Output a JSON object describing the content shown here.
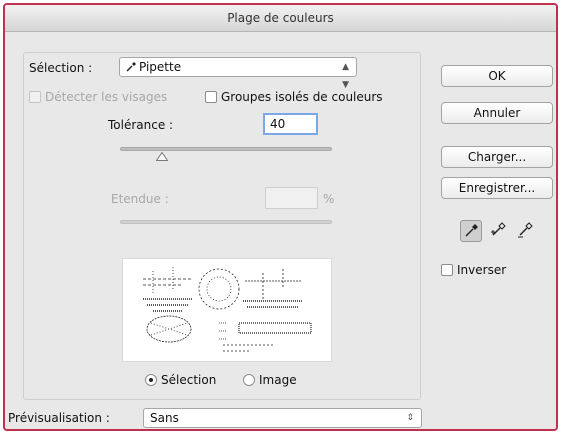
{
  "window": {
    "title": "Plage de couleurs"
  },
  "selection": {
    "label": "Sélection :",
    "value": "Pipette"
  },
  "options": {
    "detect_faces": "Détecter les visages",
    "localized_clusters": "Groupes isolés de couleurs"
  },
  "tolerance": {
    "label": "Tolérance :",
    "value": "40",
    "level_fraction": 0.2
  },
  "range": {
    "label": "Etendue :",
    "value": "",
    "unit": "%"
  },
  "preview_modes": {
    "selection": "Sélection",
    "image": "Image",
    "selected": "selection"
  },
  "preview": {
    "label": "Prévisualisation :",
    "value": "Sans"
  },
  "buttons": {
    "ok": "OK",
    "cancel": "Annuler",
    "load": "Charger...",
    "save": "Enregistrer..."
  },
  "invert": {
    "label": "Inverser",
    "checked": false
  },
  "tools": [
    "eyedropper-icon",
    "eyedropper-plus-icon",
    "eyedropper-minus-icon"
  ],
  "colors": {
    "window_border": "#c0304f",
    "focus": "#7aa7e8"
  }
}
